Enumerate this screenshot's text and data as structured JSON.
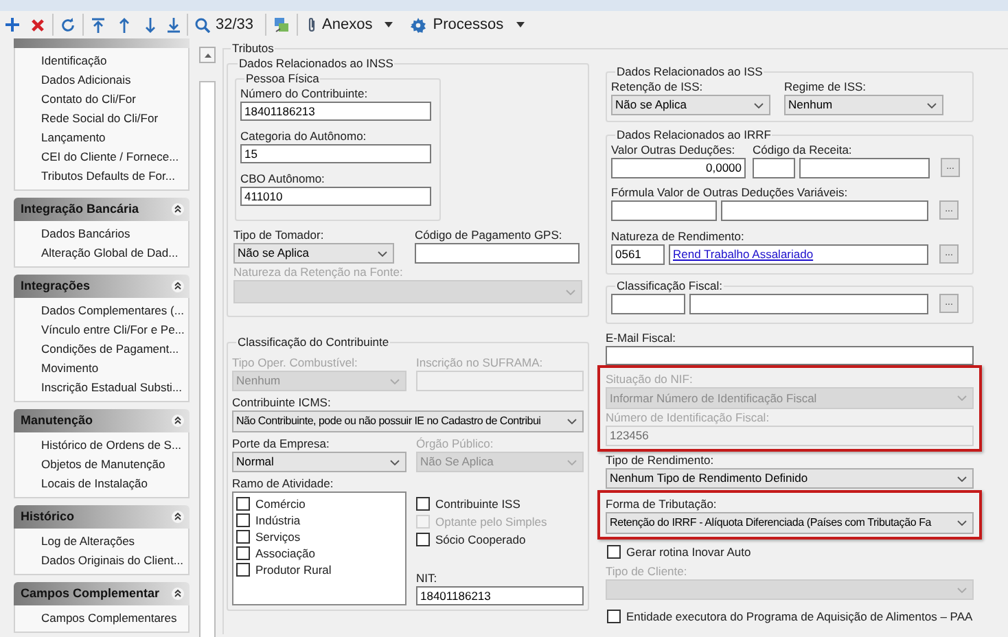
{
  "toolbar": {
    "counter": "32/33",
    "menus": [
      {
        "label": "Anexos"
      },
      {
        "label": "Processos"
      }
    ]
  },
  "sidebar": {
    "sections": [
      {
        "items": [
          "Identificação",
          "Dados Adicionais",
          "Contato do Cli/For",
          "Rede Social do Cli/For",
          "Lançamento",
          "CEI do Cliente / Fornece...",
          "Tributos Defaults de For..."
        ]
      },
      {
        "title": "Integração Bancária",
        "expanded": true,
        "items": [
          "Dados Bancários",
          "Alteração Global de Dad..."
        ]
      },
      {
        "title": "Integrações",
        "expanded": true,
        "items": [
          "Dados Complementares (...",
          "Vínculo entre Cli/For e Pe...",
          "Condições de Pagament...",
          "Movimento",
          "Inscrição Estadual Substi..."
        ]
      },
      {
        "title": "Manutenção",
        "expanded": true,
        "items": [
          "Histórico de Ordens de S...",
          "Objetos de Manutenção",
          "Locais de Instalação"
        ]
      },
      {
        "title": "Histórico",
        "expanded": true,
        "items": [
          "Log de Alterações",
          "Dados Originais do Client..."
        ]
      },
      {
        "title": "Campos Complementar",
        "expanded": true,
        "items": [
          "Campos Complementares"
        ]
      }
    ]
  },
  "form": {
    "legend": "Tributos",
    "inss": {
      "legend": "Dados Relacionados ao INSS",
      "pessoa_fisica": {
        "legend": "Pessoa Física",
        "fields": [
          {
            "label": "Número do Contribuinte:",
            "value": "18401186213"
          },
          {
            "label": "Categoria do Autônomo:",
            "value": "15"
          },
          {
            "label": "CBO Autônomo:",
            "value": "411010"
          }
        ]
      },
      "tipo_tomador": {
        "label": "Tipo de Tomador:",
        "value": "Não se Aplica",
        "disabled": false
      },
      "codigo_gps": {
        "label": "Código de Pagamento GPS:"
      },
      "natureza_retencao": {
        "label": "Natureza da Retenção na Fonte:",
        "disabled": true
      }
    },
    "classificacao": {
      "legend": "Classificação do Contribuinte",
      "tipo_oper": {
        "label": "Tipo Oper. Combustível:",
        "value": "Nenhum",
        "disabled": true
      },
      "suframa": {
        "label": "Inscrição no SUFRAMA:",
        "disabled": true
      },
      "icms": {
        "label": "Contribuinte ICMS:",
        "value": "Não Contribuinte, pode ou não possuir IE no Cadastro de Contribui",
        "disabled": false
      },
      "porte": {
        "label": "Porte da Empresa:",
        "value": "Normal",
        "disabled": false
      },
      "orgao": {
        "label": "Órgão Público:",
        "value": "Não Se Aplica",
        "disabled": true
      },
      "ramo": {
        "label": "Ramo de Atividade:",
        "options": [
          {
            "label": "Comércio",
            "checked": false
          },
          {
            "label": "Indústria",
            "checked": false
          },
          {
            "label": "Serviços",
            "checked": false
          },
          {
            "label": "Associação",
            "checked": false
          },
          {
            "label": "Produtor Rural",
            "checked": false
          }
        ]
      },
      "flags": [
        {
          "label": "Contribuinte ISS",
          "checked": false,
          "disabled": false
        },
        {
          "label": "Optante pelo Simples",
          "checked": false,
          "disabled": true
        },
        {
          "label": "Sócio Cooperado",
          "checked": false,
          "disabled": false
        }
      ],
      "nit": {
        "label": "NIT:",
        "value": "18401186213"
      }
    },
    "iss": {
      "legend": "Dados Relacionados ao ISS",
      "retencao": {
        "label": "Retenção de ISS:",
        "value": "Não se Aplica",
        "disabled": false
      },
      "regime": {
        "label": "Regime de ISS:",
        "value": "Nenhum",
        "disabled": false
      }
    },
    "irrf": {
      "legend": "Dados Relacionados ao IRRF",
      "valor_outras": {
        "label": "Valor Outras Deduções:",
        "value": "0,0000"
      },
      "codigo_receita": {
        "label": "Código da Receita:",
        "button": "..."
      },
      "formula": {
        "label": "Fórmula Valor de Outras Deduções Variáveis:",
        "button": "..."
      },
      "natureza": {
        "label": "Natureza de Rendimento:",
        "code": "0561",
        "link": "Rend Trabalho Assalariado",
        "button": "..."
      }
    },
    "classificacao_fiscal": {
      "legend": "Classificação Fiscal:",
      "button": "..."
    },
    "email_fiscal": {
      "label": "E-Mail Fiscal:"
    },
    "nif": {
      "highlighted": true,
      "situacao": {
        "label": "Situação do NIF:",
        "value": "Informar Número de Identificação Fiscal",
        "disabled": true
      },
      "numero": {
        "label": "Número de Identificação Fiscal:",
        "value": "123456",
        "disabled": true
      }
    },
    "tipo_rendimento": {
      "label": "Tipo de Rendimento:",
      "value": "Nenhum Tipo de Rendimento Definido",
      "disabled": false
    },
    "forma_tributacao": {
      "highlighted": true,
      "label": "Forma de Tributação:",
      "value": "Retenção do IRRF - Alíquota Diferenciada (Países com Tributação Fa",
      "disabled": false
    },
    "gerar_rotina": {
      "label": "Gerar rotina Inovar Auto",
      "checked": false,
      "disabled": false
    },
    "tipo_cliente": {
      "label": "Tipo de Cliente:",
      "disabled": true
    },
    "entidade_paa": {
      "label": "Entidade executora do Programa de Aquisição de Alimentos – PAA",
      "checked": false,
      "disabled": false
    }
  }
}
